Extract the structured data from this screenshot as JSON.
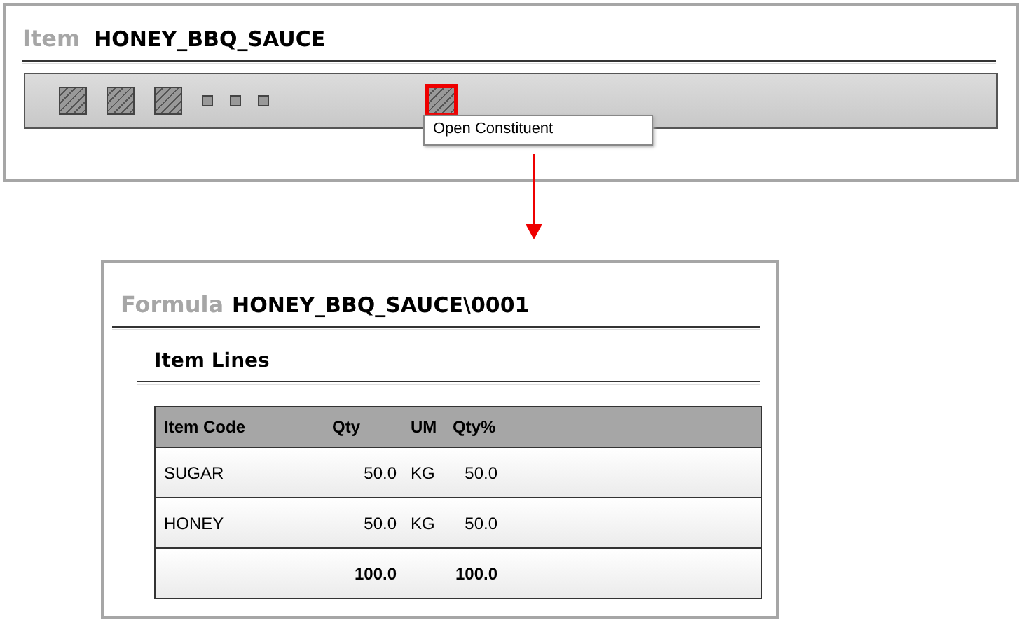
{
  "item_panel": {
    "label": "Item",
    "value": "HONEY_BBQ_SAUCE",
    "toolbar": [
      {
        "kind": "large",
        "selected": false
      },
      {
        "kind": "large",
        "selected": false
      },
      {
        "kind": "large",
        "selected": false
      },
      {
        "kind": "small",
        "selected": false
      },
      {
        "kind": "small",
        "selected": false
      },
      {
        "kind": "small",
        "selected": false
      },
      {
        "kind": "large",
        "selected": true
      }
    ],
    "tooltip": "Open Constituent"
  },
  "formula_panel": {
    "label": "Formula",
    "value": "HONEY_BBQ_SAUCE\\0001",
    "section_title": "Item Lines",
    "table": {
      "columns": [
        "Item Code",
        "Qty",
        "UM",
        "Qty%"
      ],
      "rows": [
        {
          "kind": "line",
          "item_code": "SUGAR",
          "qty": "50.0",
          "um": "KG",
          "qty_pct": "50.0"
        },
        {
          "kind": "line",
          "item_code": "HONEY",
          "qty": "50.0",
          "um": "KG",
          "qty_pct": "50.0"
        },
        {
          "kind": "total",
          "qty": "100.0",
          "qty_pct": "100.0"
        }
      ]
    }
  }
}
